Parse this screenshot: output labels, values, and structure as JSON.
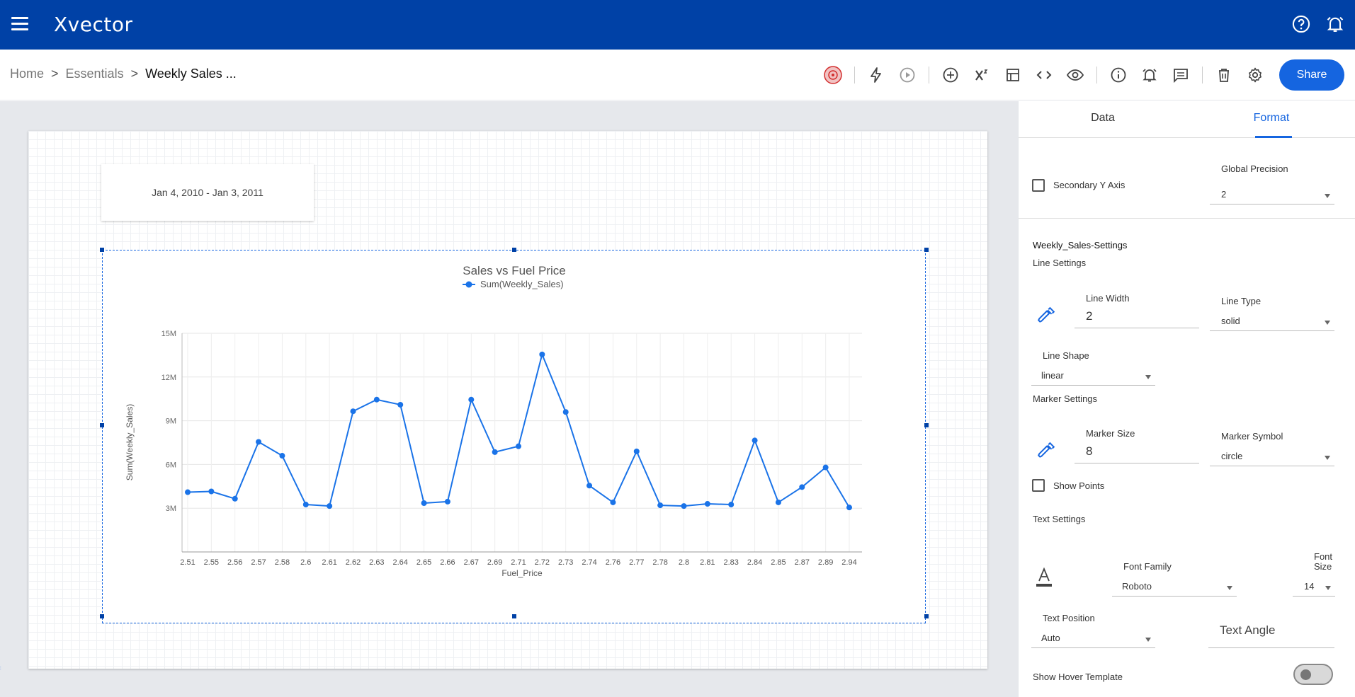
{
  "app": {
    "name": "Xvector"
  },
  "breadcrumb": {
    "home": "Home",
    "sep1": ">",
    "essentials": "Essentials",
    "sep2": ">",
    "current": "Weekly Sales ..."
  },
  "toolbar": {
    "share_label": "Share"
  },
  "canvas": {
    "date_range": "Jan 4, 2010 - Jan 3, 2011"
  },
  "panel": {
    "tabs": [
      "Data",
      "Format"
    ],
    "active_tab": "Format",
    "secondary_y_axis": "Secondary Y Axis",
    "global_precision": {
      "label": "Global Precision",
      "value": "2"
    },
    "series_settings_title": "Weekly_Sales-Settings",
    "line_settings": "Line Settings",
    "line_width": {
      "label": "Line Width",
      "value": "2"
    },
    "line_type": {
      "label": "Line Type",
      "value": "solid"
    },
    "line_shape": {
      "label": "Line Shape",
      "value": "linear"
    },
    "marker_settings": "Marker Settings",
    "marker_size": {
      "label": "Marker Size",
      "value": "8"
    },
    "marker_symbol": {
      "label": "Marker Symbol",
      "value": "circle"
    },
    "show_points": "Show Points",
    "text_settings": "Text Settings",
    "font_family": {
      "label": "Font Family",
      "value": "Roboto"
    },
    "font_size": {
      "label_line1": "Font",
      "label_line2": "Size",
      "value": "14"
    },
    "text_position": {
      "label": "Text Position",
      "value": "Auto"
    },
    "text_angle": "Text Angle",
    "show_hover_template": "Show Hover Template"
  },
  "colors": {
    "brand": "#0041a6",
    "accent": "#1565e0",
    "line": "#1a73e8"
  },
  "chart_data": {
    "type": "line",
    "title": "Sales vs Fuel Price",
    "xlabel": "Fuel_Price",
    "ylabel": "Sum(Weekly_Sales)",
    "legend": "top-center",
    "grid": true,
    "ylim": [
      0,
      15000000
    ],
    "yticks": [
      "3M",
      "6M",
      "9M",
      "12M",
      "15M"
    ],
    "categories": [
      "2.51",
      "2.55",
      "2.56",
      "2.57",
      "2.58",
      "2.6",
      "2.61",
      "2.62",
      "2.63",
      "2.64",
      "2.65",
      "2.66",
      "2.67",
      "2.69",
      "2.71",
      "2.72",
      "2.73",
      "2.74",
      "2.76",
      "2.77",
      "2.78",
      "2.8",
      "2.81",
      "2.83",
      "2.84",
      "2.85",
      "2.87",
      "2.89",
      "2.94"
    ],
    "series": [
      {
        "name": "Sum(Weekly_Sales)",
        "values": [
          4100000,
          4150000,
          3650000,
          7550000,
          6600000,
          3250000,
          3150000,
          9650000,
          10450000,
          10100000,
          3350000,
          3450000,
          10450000,
          6850000,
          7250000,
          13550000,
          9600000,
          4550000,
          3400000,
          6900000,
          3200000,
          3150000,
          3300000,
          3250000,
          7650000,
          3400000,
          4450000,
          5800000,
          3050000
        ]
      }
    ]
  }
}
